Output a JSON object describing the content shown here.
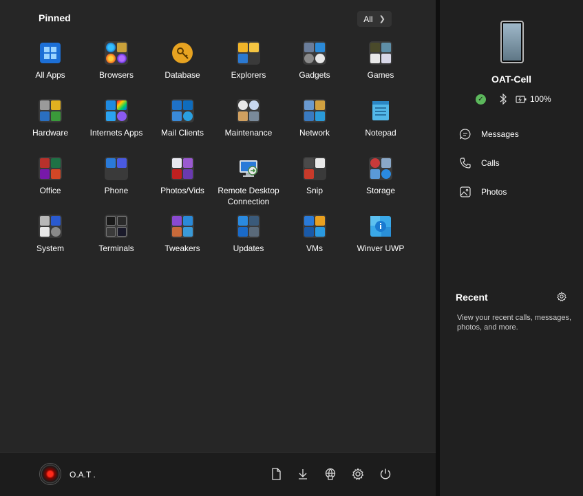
{
  "pinned": {
    "title": "Pinned",
    "all_label": "All",
    "tiles": [
      {
        "label": "All Apps",
        "icon": "windows-logo-icon"
      },
      {
        "label": "Browsers",
        "icon": "browsers-folder-icon"
      },
      {
        "label": "Database",
        "icon": "key-icon"
      },
      {
        "label": "Explorers",
        "icon": "explorers-folder-icon"
      },
      {
        "label": "Gadgets",
        "icon": "gadgets-folder-icon"
      },
      {
        "label": "Games",
        "icon": "games-folder-icon"
      },
      {
        "label": "Hardware",
        "icon": "hardware-folder-icon"
      },
      {
        "label": "Internets Apps",
        "icon": "internet-apps-folder-icon"
      },
      {
        "label": "Mail Clients",
        "icon": "mail-clients-folder-icon"
      },
      {
        "label": "Maintenance",
        "icon": "maintenance-folder-icon"
      },
      {
        "label": "Network",
        "icon": "network-folder-icon"
      },
      {
        "label": "Notepad",
        "icon": "notepad-icon"
      },
      {
        "label": "Office",
        "icon": "office-folder-icon"
      },
      {
        "label": "Phone",
        "icon": "phone-folder-icon"
      },
      {
        "label": "Photos/Vids",
        "icon": "photos-folder-icon"
      },
      {
        "label": "Remote Desktop Connection",
        "icon": "remote-desktop-icon"
      },
      {
        "label": "Snip",
        "icon": "snip-folder-icon"
      },
      {
        "label": "Storage",
        "icon": "storage-folder-icon"
      },
      {
        "label": "System",
        "icon": "system-folder-icon"
      },
      {
        "label": "Terminals",
        "icon": "terminals-folder-icon"
      },
      {
        "label": "Tweakers",
        "icon": "tweakers-folder-icon"
      },
      {
        "label": "Updates",
        "icon": "updates-folder-icon"
      },
      {
        "label": "VMs",
        "icon": "vms-folder-icon"
      },
      {
        "label": "Winver UWP",
        "icon": "winver-info-icon"
      }
    ]
  },
  "user": {
    "name": "O.A.T ."
  },
  "phone_panel": {
    "device_name": "OAT-Cell",
    "battery": "100%",
    "items": [
      {
        "label": "Messages",
        "icon": "message-icon"
      },
      {
        "label": "Calls",
        "icon": "phone-icon"
      },
      {
        "label": "Photos",
        "icon": "photo-icon"
      }
    ],
    "recent_title": "Recent",
    "recent_text": "View your recent calls, messages, photos, and more."
  },
  "colors": {
    "panel_bg": "#262626",
    "side_bg": "#202020",
    "status_ok": "#5cb85c"
  }
}
